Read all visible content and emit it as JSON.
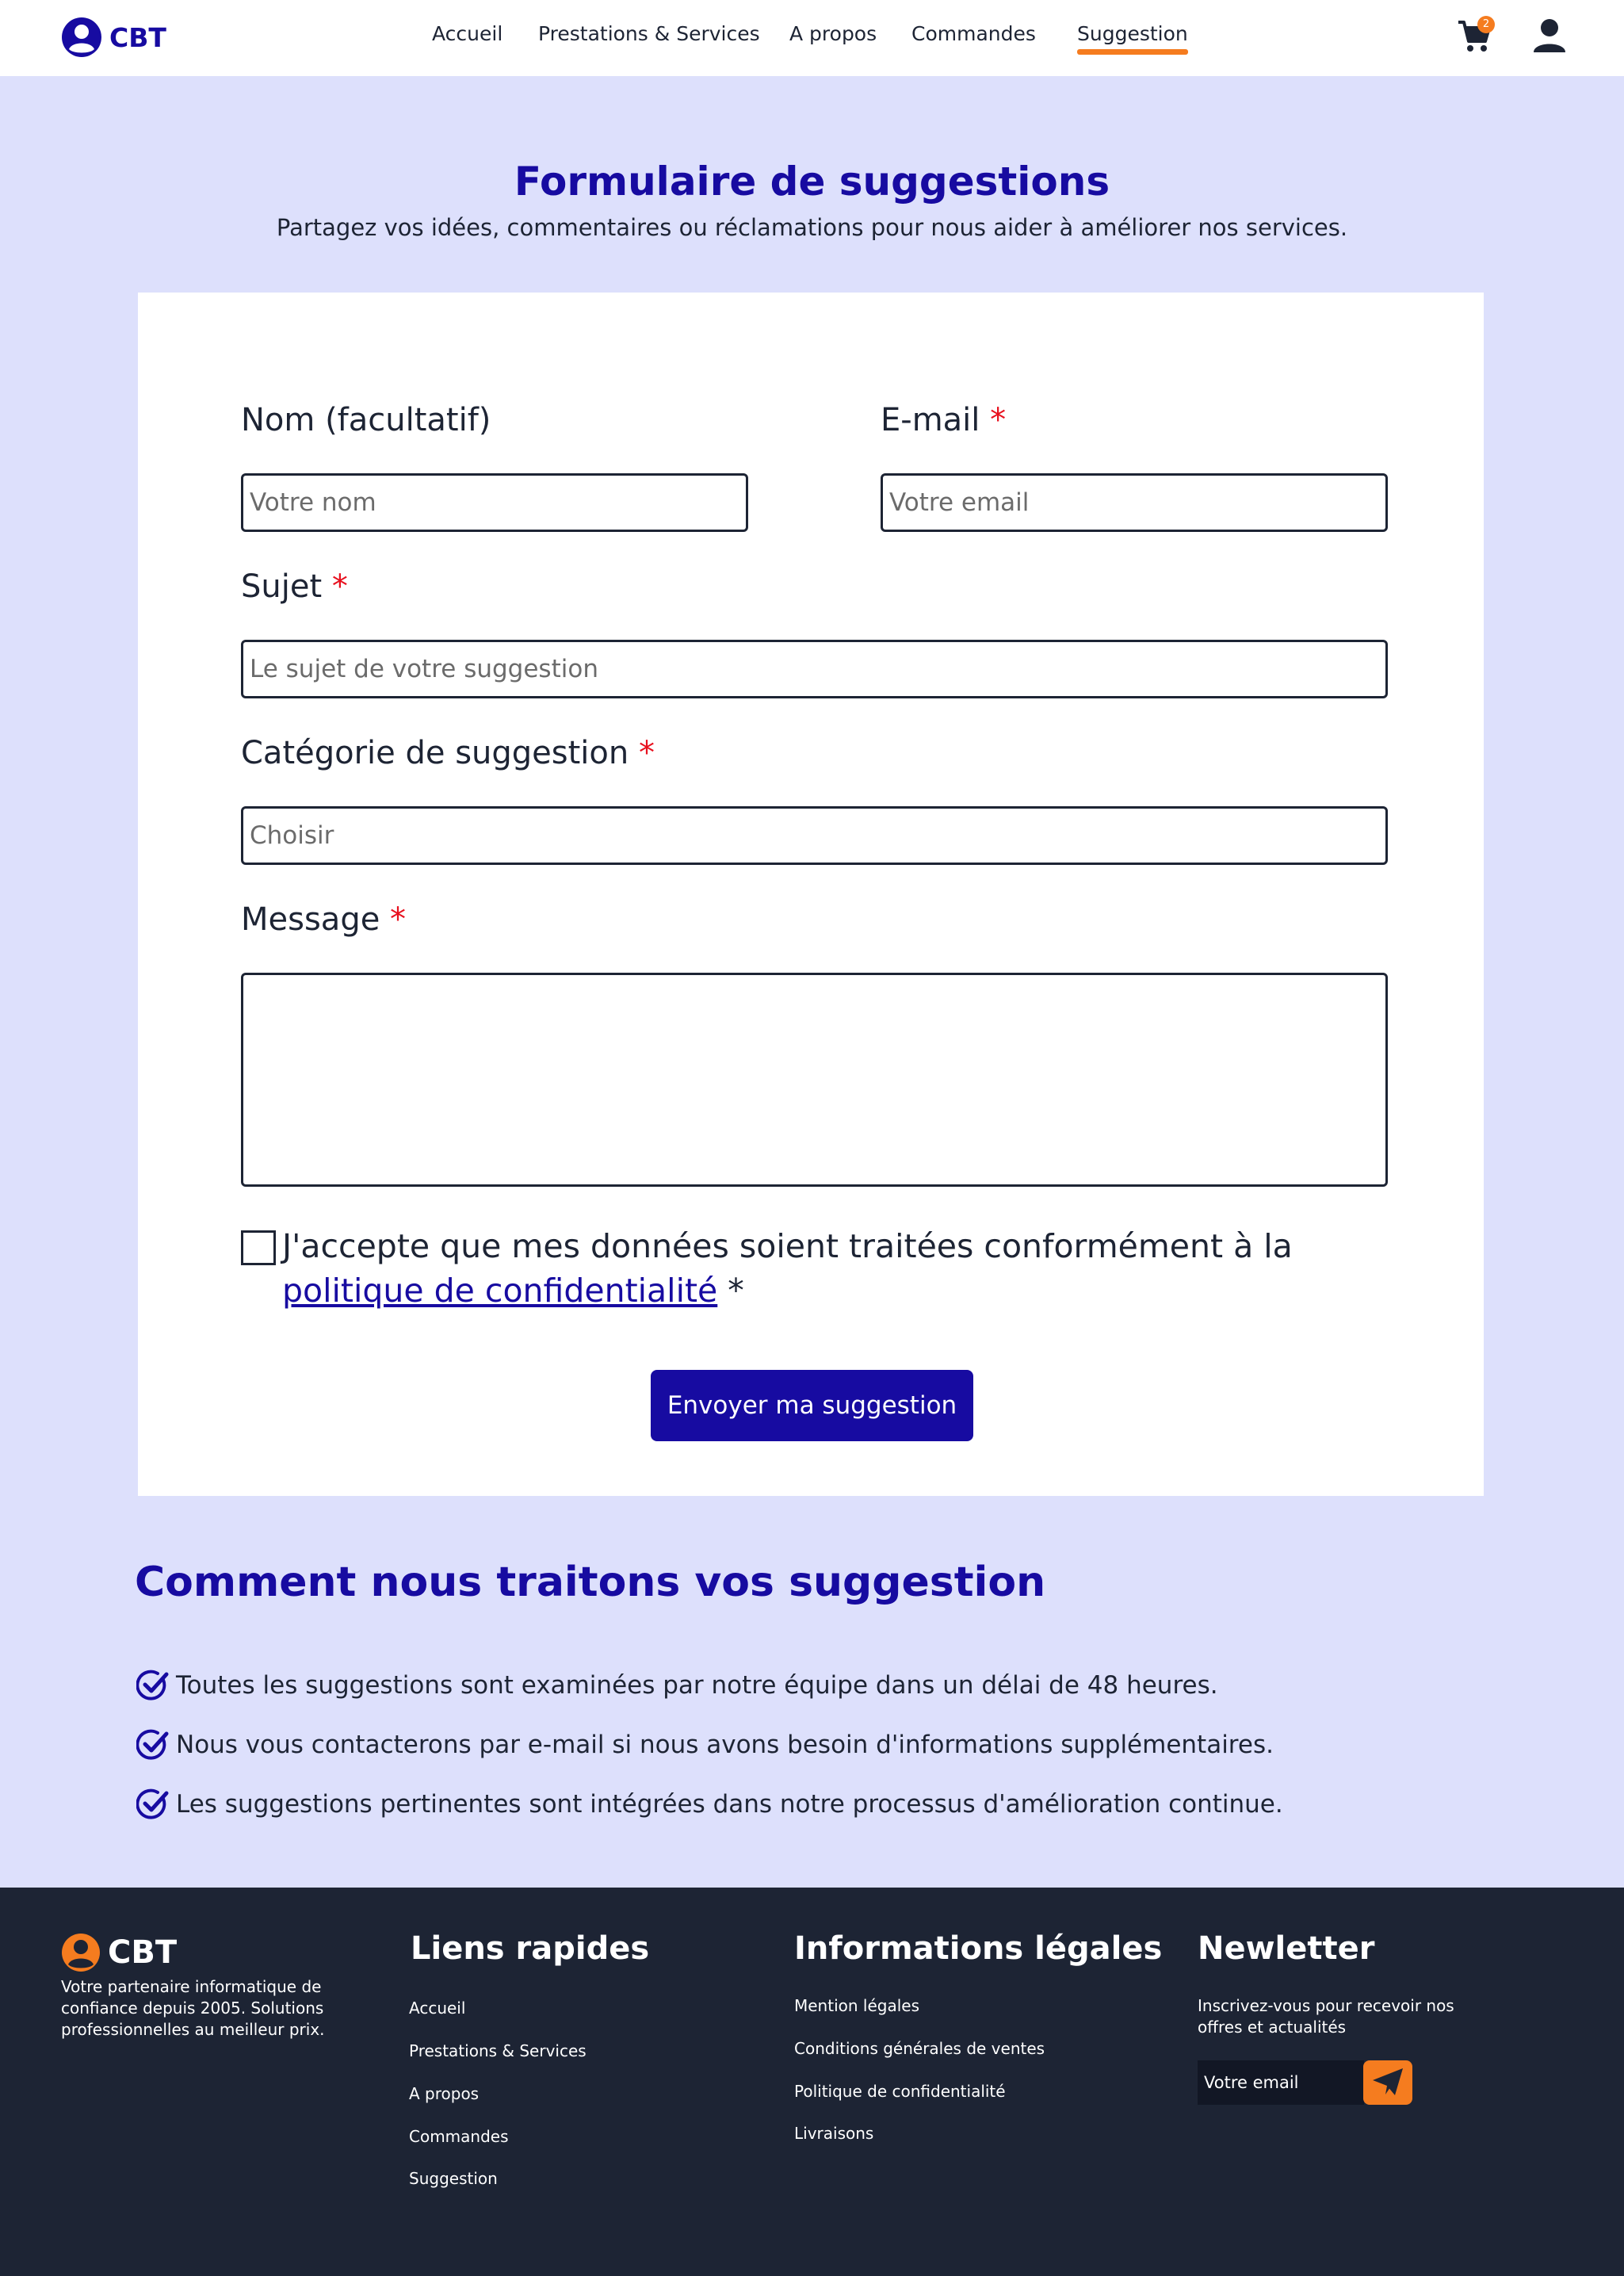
{
  "header": {
    "brand": "CBT",
    "nav": [
      {
        "label": "Accueil"
      },
      {
        "label": "Prestations & Services"
      },
      {
        "label": "A propos"
      },
      {
        "label": "Commandes"
      },
      {
        "label": "Suggestion",
        "active": true
      }
    ],
    "cart_count": "2",
    "icons": {
      "logo": "user-circle-icon",
      "cart": "cart-icon",
      "account": "user-icon"
    }
  },
  "hero": {
    "title": "Formulaire de suggestions",
    "subtitle": "Partagez vos idées, commentaires ou réclamations pour nous aider à améliorer nos services."
  },
  "form": {
    "name_label": "Nom (facultatif)",
    "name_placeholder": "Votre nom",
    "email_label": "E-mail",
    "email_placeholder": "Votre email",
    "subject_label": "Sujet",
    "subject_placeholder": "Le sujet de votre suggestion",
    "category_label": "Catégorie de suggestion",
    "category_placeholder": "Choisir",
    "message_label": "Message",
    "required_mark": "*",
    "consent_text": "J'accepte que mes données soient traitées conformément à la",
    "consent_link": "politique de confidentialité",
    "consent_suffix": " *",
    "submit_label": "Envoyer ma suggestion"
  },
  "how": {
    "title": "Comment nous traitons vos suggestion",
    "items": [
      "Toutes les suggestions sont examinées par notre équipe dans un délai de 48 heures.",
      "Nous vous contacterons par e-mail si nous avons besoin d'informations supplémentaires.",
      "Les suggestions pertinentes sont intégrées dans notre processus d'amélioration continue."
    ]
  },
  "footer": {
    "brand": "CBT",
    "description": "Votre partenaire informatique de confiance depuis 2005. Solutions professionnelles au meilleur prix.",
    "quick_links_title": "Liens rapides",
    "quick_links": [
      "Accueil",
      "Prestations & Services",
      "A propos",
      "Commandes",
      "Suggestion"
    ],
    "legal_title": "Informations légales",
    "legal_links": [
      "Mention légales",
      "Conditions générales de ventes",
      "Politique de confidentialité",
      "Livraisons"
    ],
    "newsletter_title": "Newletter",
    "newsletter_text": "Inscrivez-vous pour recevoir nos offres et actualités",
    "newsletter_placeholder": "Votre email"
  },
  "colors": {
    "primary": "#170ba1",
    "accent": "#f57c1f",
    "background": "#dde0fc",
    "footer": "#1d2434",
    "required": "#e8101e"
  }
}
